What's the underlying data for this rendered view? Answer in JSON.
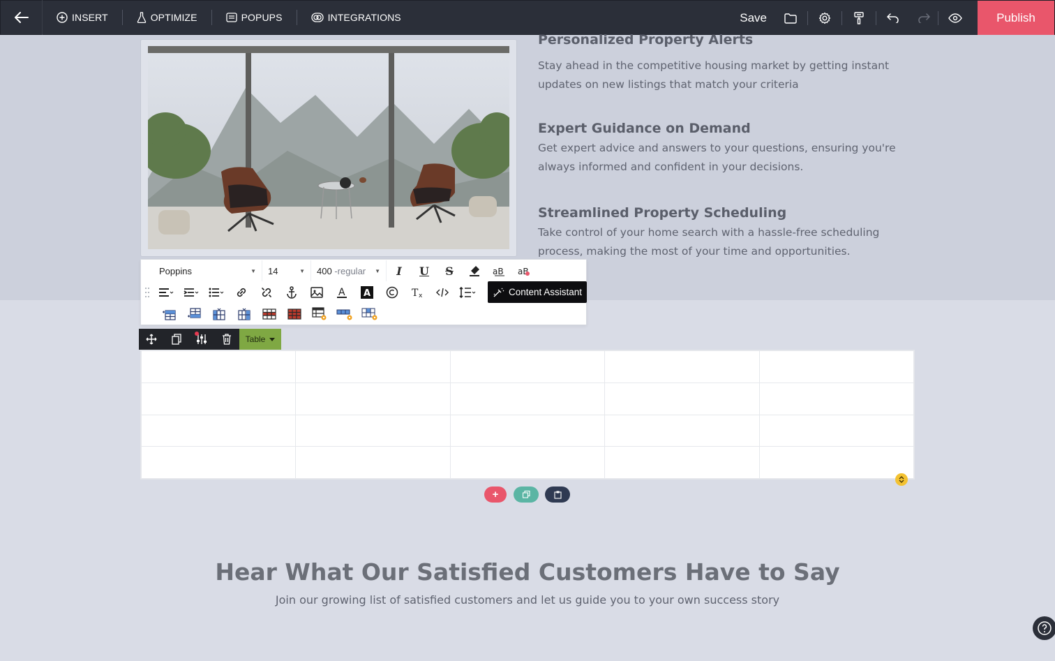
{
  "topbar": {
    "nav": [
      {
        "label": "INSERT",
        "icon": "plus-circle-icon"
      },
      {
        "label": "OPTIMIZE",
        "icon": "flask-icon"
      },
      {
        "label": "POPUPS",
        "icon": "popup-window-icon"
      },
      {
        "label": "INTEGRATIONS",
        "icon": "link-rings-icon"
      }
    ],
    "save_label": "Save",
    "publish_label": "Publish"
  },
  "features": [
    {
      "title": "Personalized Property Alerts",
      "text": "Stay ahead in the competitive housing market by getting instant updates on new listings that match your criteria"
    },
    {
      "title": "Expert Guidance on Demand",
      "text": "Get expert advice and answers to your questions, ensuring you're always informed and confident in your decisions."
    },
    {
      "title": "Streamlined Property Scheduling",
      "text": "Take control of your home search with a hassle-free scheduling process, making the most of your time and opportunities."
    }
  ],
  "editor": {
    "font_family": "Poppins",
    "font_size": "14",
    "font_weight_num": "400",
    "font_weight_name": "-regular",
    "content_assistant_label": "Content Assistant"
  },
  "element_toolbar": {
    "type_label": "Table"
  },
  "table": {
    "rows": 4,
    "cols": 5
  },
  "testimonials": {
    "title": "Hear What Our Satisfied Customers Have to Say",
    "subtitle": "Join our growing list of satisfied customers and let us guide you to your own success story"
  },
  "colors": {
    "publish": "#e9566b",
    "topbar": "#2b2f39",
    "table_tag": "#7fa843",
    "add_pill": "#e9566b",
    "copy_pill": "#5bb5a4",
    "paste_pill": "#2f3a52",
    "resize_handle": "#f3c232"
  }
}
